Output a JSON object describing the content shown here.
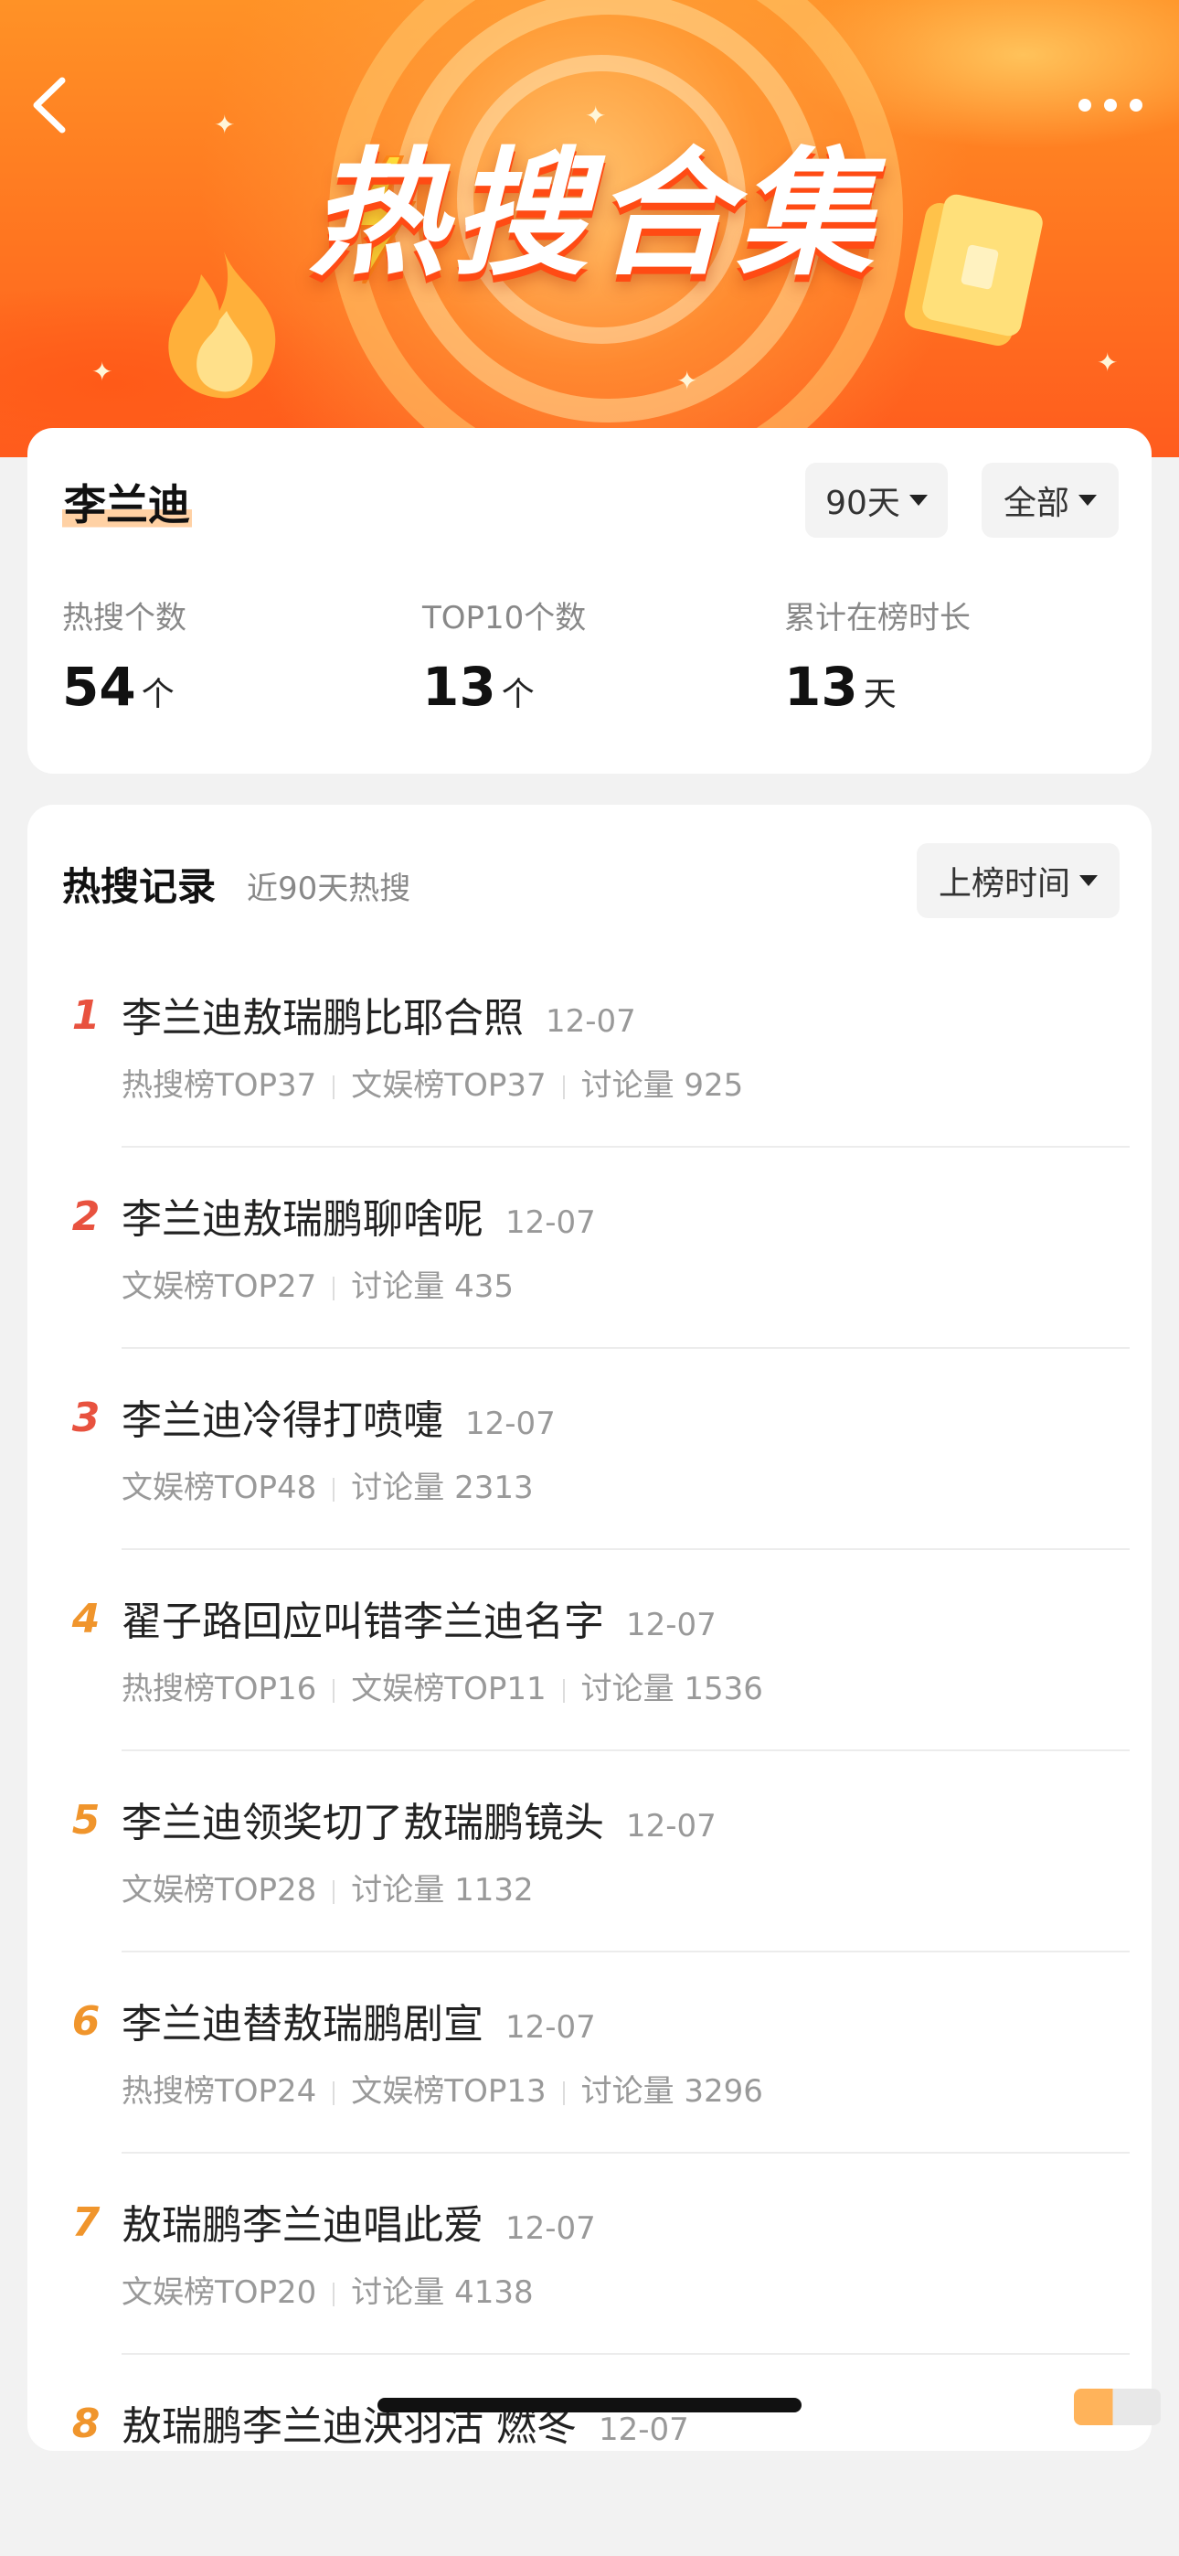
{
  "banner": {
    "title": "热搜合集",
    "back_icon": "chevron-left-icon",
    "more_icon": "more-dots-icon",
    "colors": {
      "primary": "#ff7a22",
      "highlight": "#ffd7a0"
    }
  },
  "summary": {
    "name": "李兰迪",
    "range_filter": "90天",
    "scope_filter": "全部",
    "stats": [
      {
        "label": "热搜个数",
        "value": "54",
        "unit": "个"
      },
      {
        "label": "TOP10个数",
        "value": "13",
        "unit": "个"
      },
      {
        "label": "累计在榜时长",
        "value": "13",
        "unit": "天"
      }
    ]
  },
  "records_section": {
    "title": "热搜记录",
    "subtitle": "近90天热搜",
    "sort_filter": "上榜时间",
    "rank_colors": {
      "top3": "#e8523f",
      "rest": "#f0952c"
    },
    "items": [
      {
        "rank": "1",
        "title": "李兰迪敖瑞鹏比耶合照",
        "date": "12-07",
        "tags": [
          "热搜榜TOP37",
          "文娱榜TOP37",
          "讨论量 925"
        ]
      },
      {
        "rank": "2",
        "title": "李兰迪敖瑞鹏聊啥呢",
        "date": "12-07",
        "tags": [
          "文娱榜TOP27",
          "讨论量 435"
        ]
      },
      {
        "rank": "3",
        "title": "李兰迪冷得打喷嚏",
        "date": "12-07",
        "tags": [
          "文娱榜TOP48",
          "讨论量 2313"
        ]
      },
      {
        "rank": "4",
        "title": "翟子路回应叫错李兰迪名字",
        "date": "12-07",
        "tags": [
          "热搜榜TOP16",
          "文娱榜TOP11",
          "讨论量 1536"
        ]
      },
      {
        "rank": "5",
        "title": "李兰迪领奖切了敖瑞鹏镜头",
        "date": "12-07",
        "tags": [
          "文娱榜TOP28",
          "讨论量 1132"
        ]
      },
      {
        "rank": "6",
        "title": "李兰迪替敖瑞鹏剧宣",
        "date": "12-07",
        "tags": [
          "热搜榜TOP24",
          "文娱榜TOP13",
          "讨论量 3296"
        ]
      },
      {
        "rank": "7",
        "title": "敖瑞鹏李兰迪唱此爱",
        "date": "12-07",
        "tags": [
          "文娱榜TOP20",
          "讨论量 4138"
        ]
      },
      {
        "rank": "8",
        "title": "敖瑞鹏李兰迪泱羽沽 燃冬",
        "date": "12-07",
        "tags": []
      }
    ]
  }
}
